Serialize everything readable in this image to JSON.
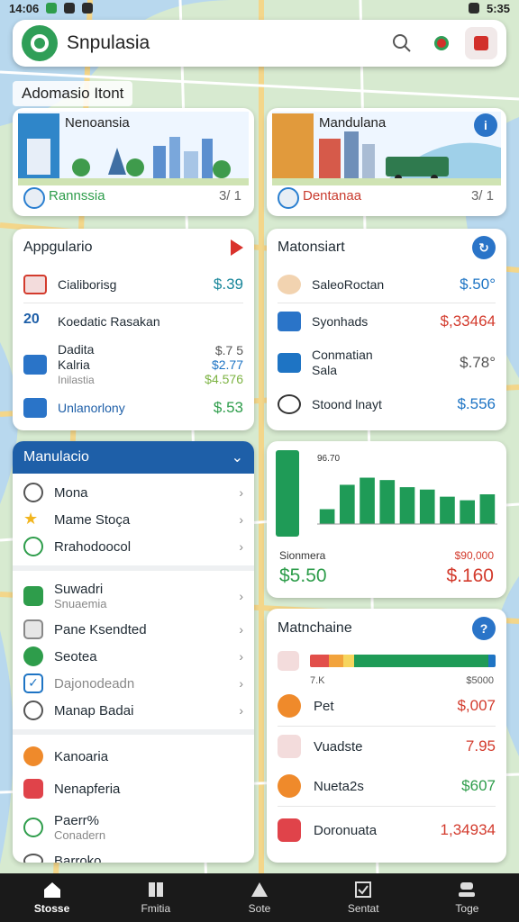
{
  "status": {
    "time": "14:06",
    "right": "5:35"
  },
  "search": {
    "title": "Snpulasia"
  },
  "section_label": "Adomasio Itont",
  "destinations": [
    {
      "title": "Nenoansia",
      "subtitle": "Rannssia",
      "count": "3/ 1",
      "icon": "globe-badge"
    },
    {
      "title": "Mandulana",
      "subtitle": "Dentanaa",
      "count": "3/ 1",
      "icon": "info-icon"
    }
  ],
  "prices_left": {
    "title": "Appgulario",
    "rows": [
      {
        "label": "Cialiborisg",
        "value": "$.39",
        "color": "teal"
      },
      {
        "label": "Koedatic Rasakan",
        "value": "",
        "color": ""
      },
      {
        "label1": "Dadita",
        "label2": "Kalria",
        "label3": "Inilastia",
        "v1": "$.7 5",
        "v2": "$2.77",
        "v3": "$4.576"
      },
      {
        "label": "Unlanorlony",
        "value": "$.53",
        "color": "green"
      }
    ]
  },
  "prices_right": {
    "title": "Matonsiart",
    "rows": [
      {
        "label": "SaleoRoctan",
        "value": "$.50°",
        "color": "blue"
      },
      {
        "label": "Syonhads",
        "value": "$,33464",
        "color": "red"
      },
      {
        "label1": "Conmatian",
        "label2": "Sala",
        "value": "$.78°",
        "color": "gray"
      },
      {
        "label": "Stoond lnayt",
        "value": "$.556",
        "color": "blue"
      }
    ]
  },
  "menu": {
    "title": "Manulacio",
    "groups": [
      [
        {
          "label": "Mona",
          "icon": "clock-icon"
        },
        {
          "label": "Mame Stoça",
          "icon": "star-icon"
        },
        {
          "label": "Rrahodoocol",
          "icon": "figure-icon"
        }
      ],
      [
        {
          "label": "Suwadri",
          "sub": "Snuaemia",
          "icon": "calendar-icon"
        },
        {
          "label": "Pane Ksendted",
          "icon": "image-icon"
        },
        {
          "label": "Seotea",
          "icon": "plus-icon"
        },
        {
          "label": "Dajonodeadn",
          "icon": "check-icon"
        },
        {
          "label": "Manap Badai",
          "icon": "map-icon"
        }
      ],
      [
        {
          "label": "Kanoaria",
          "icon": "orange-circle-icon"
        },
        {
          "label": "Nenapferia",
          "icon": "bag-icon"
        },
        {
          "label": "Paerr%",
          "sub": "Conadern",
          "icon": "leaf-icon"
        },
        {
          "label": "Barroko",
          "icon": "cloud-icon"
        }
      ]
    ]
  },
  "chart": {
    "top_label": "96.70",
    "left_label": "Sionmera",
    "right_label": "$90,000",
    "left_value": "$5.50",
    "right_value": "$.160"
  },
  "chart_data": {
    "type": "bar",
    "categories": [
      "1",
      "2",
      "3",
      "4",
      "5",
      "6",
      "7",
      "8",
      "9"
    ],
    "values": [
      25,
      66,
      78,
      74,
      62,
      58,
      46,
      40,
      50
    ],
    "ylim": [
      0,
      100
    ]
  },
  "maint": {
    "title": "Matnchaine",
    "bar_left": "7.K",
    "bar_right": "$5000",
    "rows": [
      {
        "label": "Pet",
        "value": "$,007",
        "color": "red"
      },
      {
        "label": "Vuadste",
        "value": "7.95",
        "color": "red"
      },
      {
        "label": "Nueta2s",
        "value": "$607",
        "color": "green"
      },
      {
        "label": "Doronuata",
        "value": "1,34934",
        "color": "red"
      }
    ]
  },
  "nav": [
    "Stosse",
    "Fmitia",
    "Sote",
    "Sentat",
    "Toge"
  ],
  "colors": {
    "primary": "#1e5fa8",
    "green": "#2e9d4b",
    "red": "#d33b2d",
    "teal": "#18869a"
  }
}
